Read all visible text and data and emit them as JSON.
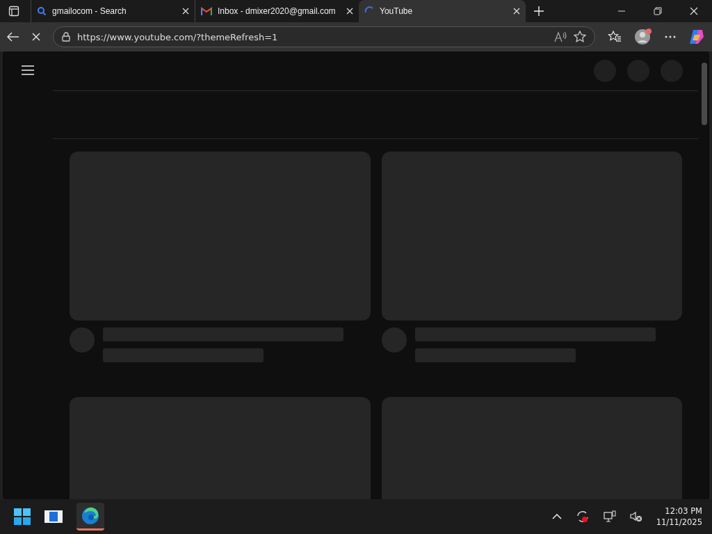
{
  "tabs": [
    {
      "title": "gmailocom - Search",
      "kind": "search",
      "selected": false
    },
    {
      "title": "Inbox - dmixer2020@gmail.com",
      "kind": "mail",
      "selected": false
    },
    {
      "title": "YouTube",
      "kind": "loading",
      "selected": true
    }
  ],
  "address_bar": {
    "url": "https://www.youtube.com/?themeRefresh=1",
    "loading": true
  },
  "page": {
    "cards": [
      {
        "kind": "skeleton"
      },
      {
        "kind": "skeleton"
      },
      {
        "kind": "thumbnail_only"
      },
      {
        "kind": "thumbnail_only"
      }
    ]
  },
  "taskbar": {
    "time": "12:03 PM",
    "date": "11/11/2025"
  }
}
